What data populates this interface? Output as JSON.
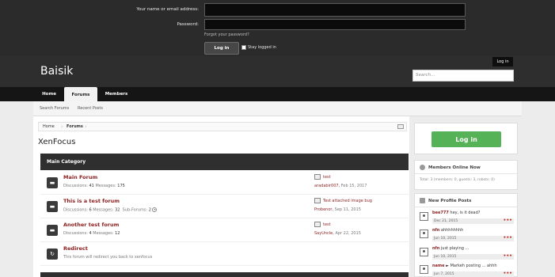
{
  "login_panel": {
    "name_label": "Your name or email address:",
    "password_label": "Password:",
    "forgot_link": "Forgot your password?",
    "login_button": "Log in",
    "stay_logged_in": "Stay logged in"
  },
  "header": {
    "logo": "Baisik",
    "login_tab": "Log in",
    "search_placeholder": "Search..."
  },
  "nav": {
    "tabs": [
      "Home",
      "Forums",
      "Members"
    ],
    "active": "Forums"
  },
  "subnav": {
    "items": [
      "Search Forums",
      "Recent Posts"
    ]
  },
  "breadcrumb": [
    "Home",
    "Forums"
  ],
  "page_title": "XenFocus",
  "category": {
    "title": "Main Category",
    "nodes": [
      {
        "title": "Main Forum",
        "discussions_label": "Discussions:",
        "discussions": "41",
        "messages_label": "Messages:",
        "messages": "175",
        "last_title": "test",
        "last_user": "aradabir007",
        "last_date": "Feb 15, 2017"
      },
      {
        "title": "This is a test forum",
        "discussions_label": "Discussions:",
        "discussions": "6",
        "messages_label": "Messages:",
        "messages": "32",
        "subforums_label": "Sub-Forums:",
        "subforums": "2",
        "last_title": "Test attached image bug",
        "last_user": "Probenor",
        "last_date": "Sep 11, 2015"
      },
      {
        "title": "Another test forum",
        "discussions_label": "Discussions:",
        "discussions": "4",
        "messages_label": "Messages:",
        "messages": "12",
        "last_title": "test",
        "last_user": "SayUncle",
        "last_date": "Apr 22, 2015"
      },
      {
        "title": "Redirect",
        "description": "This forum will redirect you back to xenfocus"
      }
    ]
  },
  "sidebar": {
    "login_button": "Log in",
    "members_online": {
      "title": "Members Online Now",
      "total": "Total: 3 (members: 0, guests: 3, robots: 0)"
    },
    "profile_posts": {
      "title": "New Profile Posts",
      "posts": [
        {
          "user": "bee777",
          "text": " hey, is it dead?",
          "date": "Dec 21, 2015"
        },
        {
          "user": "nfn",
          "text": " ahhhhhhhh",
          "date": "Jun 10, 2015"
        },
        {
          "user": "nfn",
          "text": " just playing ...",
          "date": "Jun 10, 2015"
        },
        {
          "user": "name",
          "text": " ► Markeh posting ... ahhh",
          "date": "Jun 7, 2015"
        }
      ]
    }
  },
  "colors": {
    "dark_header": "#2b2b2b",
    "link_red": "#8b1e1e",
    "login_green": "#56b256"
  }
}
